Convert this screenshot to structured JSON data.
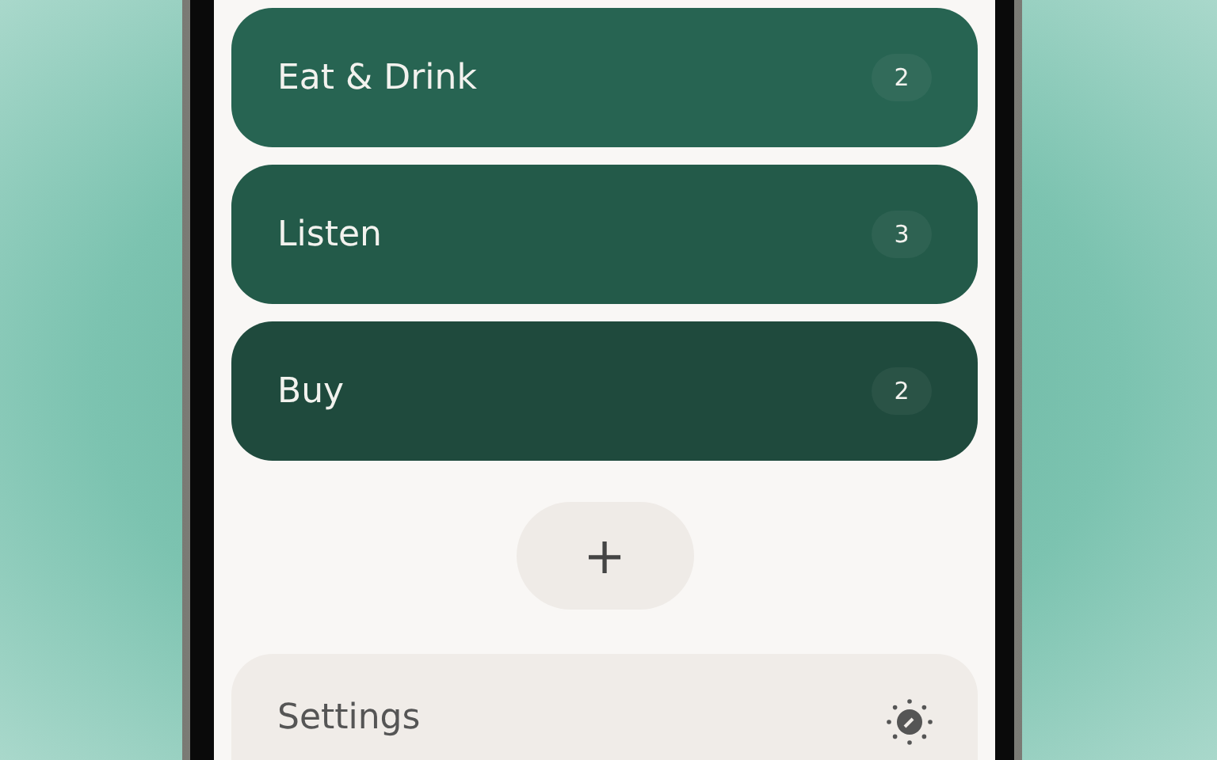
{
  "lists": [
    {
      "name": "Eat & Drink",
      "count": "2",
      "color": "#276452"
    },
    {
      "name": "Listen",
      "count": "3",
      "color": "#235a49"
    },
    {
      "name": "Buy",
      "count": "2",
      "color": "#1f4a3d"
    }
  ],
  "add_button": {
    "label": "+"
  },
  "settings": {
    "label": "Settings"
  }
}
